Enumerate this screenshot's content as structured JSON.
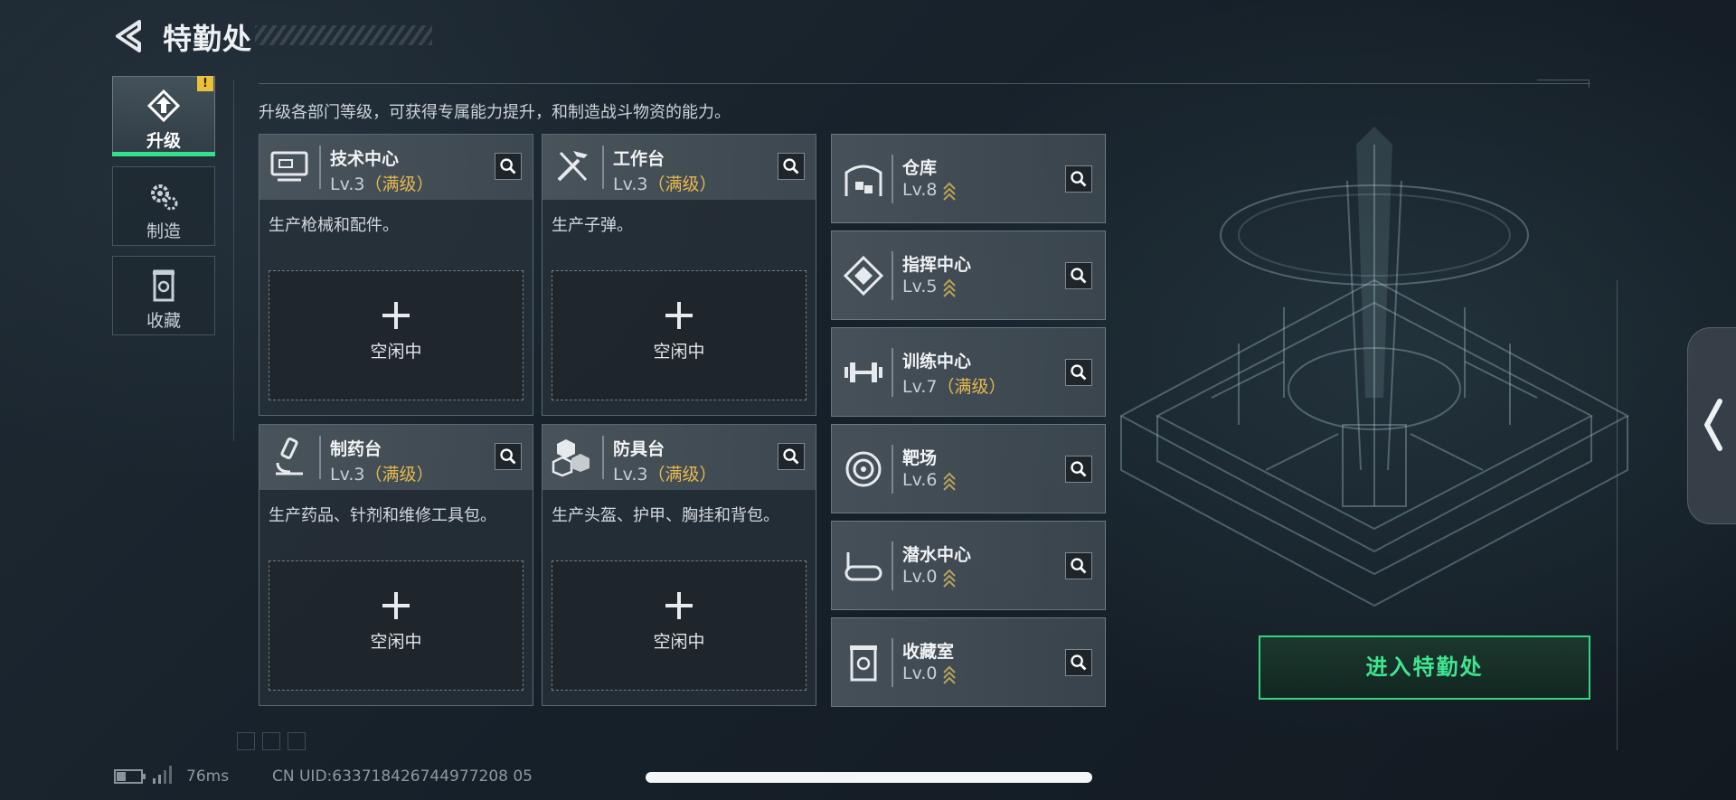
{
  "header": {
    "title": "特勤处"
  },
  "nav": {
    "items": [
      {
        "label": "升级",
        "icon": "upgrade-icon",
        "active": true,
        "alert": "!"
      },
      {
        "label": "制造",
        "icon": "gears-icon",
        "active": false
      },
      {
        "label": "收藏",
        "icon": "collection-icon",
        "active": false
      }
    ]
  },
  "description": "升级各部门等级，可获得专属能力提升，和制造战斗物资的能力。",
  "big_cards": [
    {
      "name": "技术中心",
      "level": "Lv.3",
      "maxed": "（满级）",
      "desc": "生产枪械和配件。",
      "slot": "空闲中",
      "icon": "monitor-icon"
    },
    {
      "name": "工作台",
      "level": "Lv.3",
      "maxed": "（满级）",
      "desc": "生产子弹。",
      "slot": "空闲中",
      "icon": "tools-icon"
    },
    {
      "name": "制药台",
      "level": "Lv.3",
      "maxed": "（满级）",
      "desc": "生产药品、针剂和维修工具包。",
      "slot": "空闲中",
      "icon": "microscope-icon"
    },
    {
      "name": "防具台",
      "level": "Lv.3",
      "maxed": "（满级）",
      "desc": "生产头盔、护甲、胸挂和背包。",
      "slot": "空闲中",
      "icon": "armor-icon"
    }
  ],
  "small_cards": [
    {
      "name": "仓库",
      "level": "Lv.8",
      "maxed": "",
      "icon": "warehouse-icon",
      "upgradable": true
    },
    {
      "name": "指挥中心",
      "level": "Lv.5",
      "maxed": "",
      "icon": "command-icon",
      "upgradable": true
    },
    {
      "name": "训练中心",
      "level": "Lv.7",
      "maxed": "（满级）",
      "icon": "dumbbell-icon",
      "upgradable": false
    },
    {
      "name": "靶场",
      "level": "Lv.6",
      "maxed": "",
      "icon": "target-icon",
      "upgradable": true
    },
    {
      "name": "潜水中心",
      "level": "Lv.0",
      "maxed": "",
      "icon": "diving-mask-icon",
      "upgradable": true
    },
    {
      "name": "收藏室",
      "level": "Lv.0",
      "maxed": "",
      "icon": "collection-room-icon",
      "upgradable": true
    }
  ],
  "enter_button": "进入特勤处",
  "status": {
    "ping": "76ms",
    "uid": "CN UID:633718426744977208 05"
  },
  "colors": {
    "accent": "#35e08c",
    "maxed": "#e6b94e",
    "alert": "#e9c23a",
    "chevron": "#b9a45a"
  }
}
